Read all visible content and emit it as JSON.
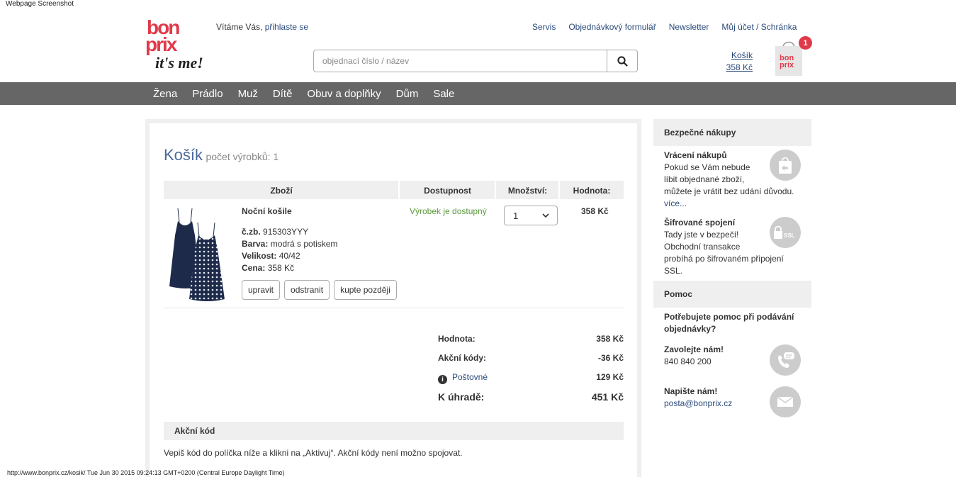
{
  "caption": {
    "top": "Webpage Screenshot",
    "bottom": "http://www.bonprix.cz/kosik/ Tue Jun 30 2015 09:24:13 GMT+0200 (Central Europe Daylight Time)"
  },
  "header": {
    "logo": {
      "line1": "bon",
      "line2": "prix",
      "tagline": "it's me!"
    },
    "welcome_text": "Vítáme Vás,",
    "login_link": "přihlaste se",
    "top_links": [
      "Servis",
      "Objednávkový formulář",
      "Newsletter",
      "Můj účet / Schránka"
    ],
    "search_placeholder": "objednací číslo / název",
    "cart_label": "Košík",
    "cart_total": "358 Kč",
    "cart_badge": "1",
    "bag_logo_line1": "bon",
    "bag_logo_line2": "prix"
  },
  "nav": {
    "items": [
      "Žena",
      "Prádlo",
      "Muž",
      "Dítě",
      "Obuv a doplňky",
      "Dům",
      "Sale"
    ]
  },
  "cart": {
    "title": "Košík",
    "item_count": "počet výrobků: 1",
    "columns": [
      "Zboží",
      "Dostupnost",
      "Množství:",
      "Hodnota:"
    ],
    "item": {
      "name": "Noční košile",
      "order_no_label": "č.zb.",
      "order_no": "915303YYY",
      "color_label": "Barva:",
      "color": "modrá s potiskem",
      "size_label": "Velikost:",
      "size": "40/42",
      "price_label": "Cena:",
      "price": "358 Kč",
      "availability": "Výrobek je dostupný",
      "quantity": "1",
      "value": "358 Kč",
      "buttons": [
        "upravit",
        "odstranit",
        "kupte později"
      ]
    },
    "summary": {
      "value_label": "Hodnota:",
      "value": "358 Kč",
      "promo_label": "Akční kódy:",
      "promo": "-36 Kč",
      "shipping_label": "Poštovné",
      "shipping": "129 Kč",
      "total_label": "K úhradě:",
      "total": "451 Kč"
    },
    "promo_section": {
      "title": "Akční kód",
      "text": "Vepiš kód do políčka níže a klikni na „Aktivuj“. Akční kódy není možno spojovat."
    }
  },
  "sidebar": {
    "safe_title": "Bezpečné nákupy",
    "returns_title": "Vrácení nákupů",
    "returns_text_1": "Pokud se Vám nebude",
    "returns_text_2": "líbit objednané zboží,",
    "returns_text_3": "můžete je vrátit bez udání důvodu.",
    "returns_more": "více...",
    "ssl_title": "Šifrované spojení",
    "ssl_text_1": "Tady jste v bezpečí!",
    "ssl_text_2": "Obchodní transakce",
    "ssl_text_3": "probíhá po šifrovaném připojení",
    "ssl_text_4": "SSL.",
    "ssl_icon_text": "SSL",
    "help_title": "Pomoc",
    "help_question_1": "Potřebujete pomoc při podávání",
    "help_question_2": "objednávky?",
    "call_title": "Zavolejte nám!",
    "phone": "840 840 200",
    "write_title": "Napište nám!",
    "email": "posta@bonprix.cz"
  },
  "colors": {
    "brand_red": "#e03a4a",
    "nav_gray": "#666666",
    "link_blue": "#2a4a7a",
    "available_green": "#5a9a3a",
    "navy_dress": "#1e2a4a"
  }
}
